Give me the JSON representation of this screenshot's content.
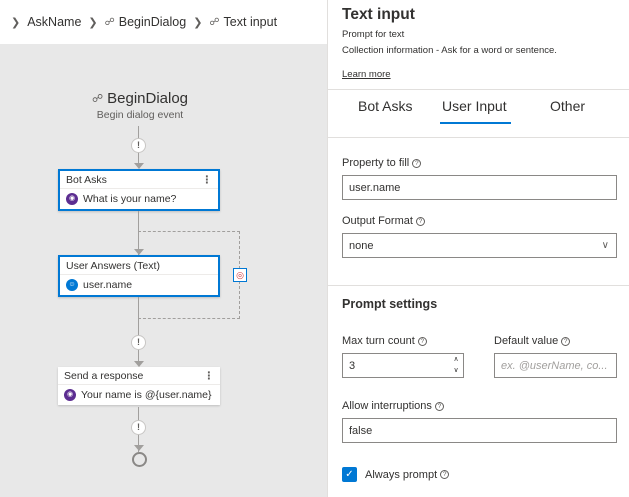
{
  "breadcrumb": {
    "items": [
      "AskName",
      "BeginDialog",
      "Text input"
    ]
  },
  "canvas": {
    "trigger_title": "BeginDialog",
    "trigger_subtitle": "Begin dialog event",
    "nodes": [
      {
        "header": "Bot Asks",
        "body": "What is your name?"
      },
      {
        "header": "User Answers (Text)",
        "body": "user.name"
      },
      {
        "header": "Send a response",
        "body": "Your name is @{user.name}"
      }
    ]
  },
  "panel": {
    "title": "Text input",
    "subtitle": "Prompt for text",
    "description": "Collection information - Ask for a word or sentence.",
    "learn_more": "Learn more",
    "tabs": [
      "Bot Asks",
      "User Input",
      "Other"
    ],
    "active_tab": "User Input",
    "property_label": "Property to fill",
    "property_value": "user.name",
    "output_format_label": "Output Format",
    "output_format_value": "none",
    "section_title": "Prompt settings",
    "max_turn_label": "Max turn count",
    "max_turn_value": "3",
    "default_value_label": "Default value",
    "default_value_placeholder": "ex. @userName, co...",
    "allow_interruptions_label": "Allow interruptions",
    "allow_interruptions_value": "false",
    "always_prompt_label": "Always prompt"
  },
  "colors": {
    "accent": "#0078d4",
    "bot_icon": "#5c2d91"
  }
}
